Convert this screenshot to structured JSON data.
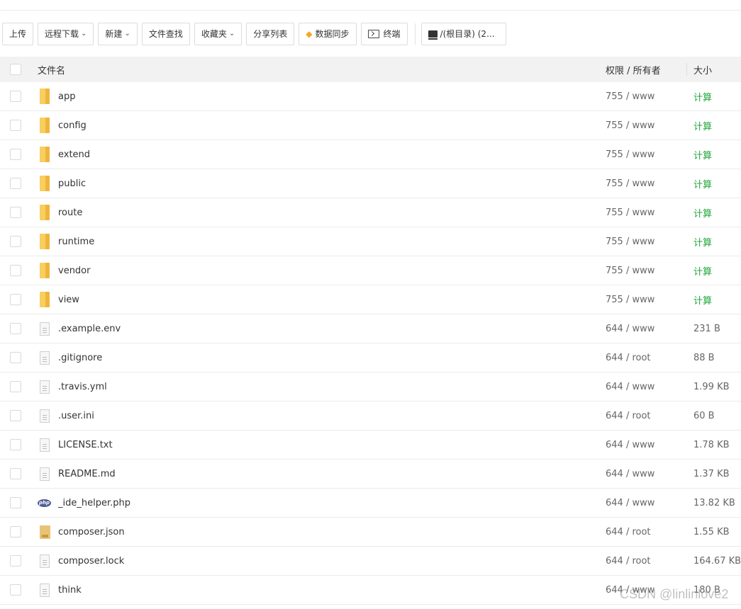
{
  "toolbar": {
    "upload": "上传",
    "remote_download": "远程下载",
    "new": "新建",
    "file_search": "文件查找",
    "favorites": "收藏夹",
    "share_list": "分享列表",
    "data_sync": "数据同步",
    "terminal": "终端",
    "root_dir": "/(根目录) (2..."
  },
  "table": {
    "header": {
      "name": "文件名",
      "perm": "权限 / 所有者",
      "size": "大小"
    },
    "rows": [
      {
        "name": "app",
        "perm": "755 / www",
        "size": "计算",
        "icon": "folder-icon"
      },
      {
        "name": "config",
        "perm": "755 / www",
        "size": "计算",
        "icon": "folder-icon"
      },
      {
        "name": "extend",
        "perm": "755 / www",
        "size": "计算",
        "icon": "folder-icon"
      },
      {
        "name": "public",
        "perm": "755 / www",
        "size": "计算",
        "icon": "folder-icon"
      },
      {
        "name": "route",
        "perm": "755 / www",
        "size": "计算",
        "icon": "folder-icon"
      },
      {
        "name": "runtime",
        "perm": "755 / www",
        "size": "计算",
        "icon": "folder-icon"
      },
      {
        "name": "vendor",
        "perm": "755 / www",
        "size": "计算",
        "icon": "folder-icon"
      },
      {
        "name": "view",
        "perm": "755 / www",
        "size": "计算",
        "icon": "folder-icon"
      },
      {
        "name": ".example.env",
        "perm": "644 / www",
        "size": "231 B",
        "icon": "file-icon"
      },
      {
        "name": ".gitignore",
        "perm": "644 / root",
        "size": "88 B",
        "icon": "file-icon"
      },
      {
        "name": ".travis.yml",
        "perm": "644 / www",
        "size": "1.99 KB",
        "icon": "file-icon"
      },
      {
        "name": ".user.ini",
        "perm": "644 / root",
        "size": "60 B",
        "icon": "file-icon"
      },
      {
        "name": "LICENSE.txt",
        "perm": "644 / www",
        "size": "1.78 KB",
        "icon": "file-icon"
      },
      {
        "name": "README.md",
        "perm": "644 / www",
        "size": "1.37 KB",
        "icon": "file-icon"
      },
      {
        "name": "_ide_helper.php",
        "perm": "644 / www",
        "size": "13.82 KB",
        "icon": "php-icon"
      },
      {
        "name": "composer.json",
        "perm": "644 / root",
        "size": "1.55 KB",
        "icon": "json-icon"
      },
      {
        "name": "composer.lock",
        "perm": "644 / root",
        "size": "164.67 KB",
        "icon": "file-icon"
      },
      {
        "name": "think",
        "perm": "644 / www",
        "size": "180 B",
        "icon": "file-icon"
      }
    ]
  },
  "watermark": "CSDN @linlinlove2",
  "colors": {
    "calc_link": "#20a53a",
    "header_bg": "#f2f2f2",
    "folder": "#f0b43c"
  }
}
